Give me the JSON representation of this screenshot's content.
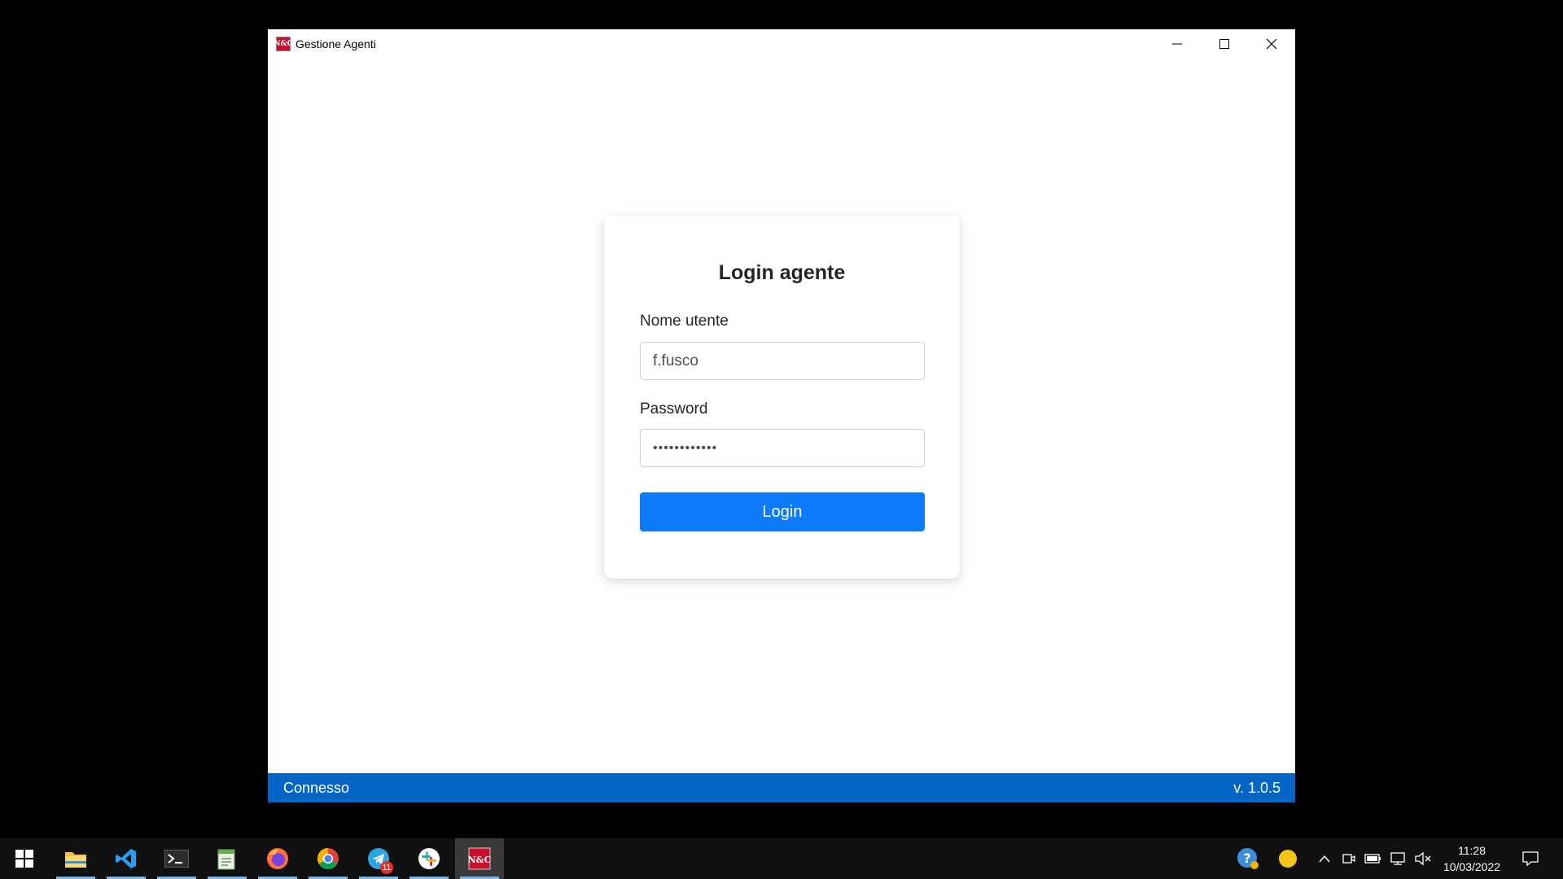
{
  "window": {
    "title": "Gestione Agenti",
    "app_icon_text": "N&C"
  },
  "login": {
    "title": "Login agente",
    "username_label": "Nome utente",
    "username_value": "f.fusco",
    "password_label": "Password",
    "password_value": "••••••••••••",
    "button_label": "Login"
  },
  "status": {
    "connection": "Connesso",
    "version": "v. 1.0.5"
  },
  "taskbar": {
    "apps": [
      {
        "name": "windows-start-icon"
      },
      {
        "name": "file-explorer-icon"
      },
      {
        "name": "vscode-icon"
      },
      {
        "name": "terminal-icon"
      },
      {
        "name": "notepad-icon"
      },
      {
        "name": "firefox-icon"
      },
      {
        "name": "chrome-icon"
      },
      {
        "name": "telegram-icon",
        "badge": "11"
      },
      {
        "name": "slack-icon"
      },
      {
        "name": "gestione-agenti-icon"
      }
    ],
    "clock_time": "11:28",
    "clock_date": "10/03/2022"
  },
  "colors": {
    "accent": "#0d7bfa",
    "statusbar": "#0366c6"
  }
}
